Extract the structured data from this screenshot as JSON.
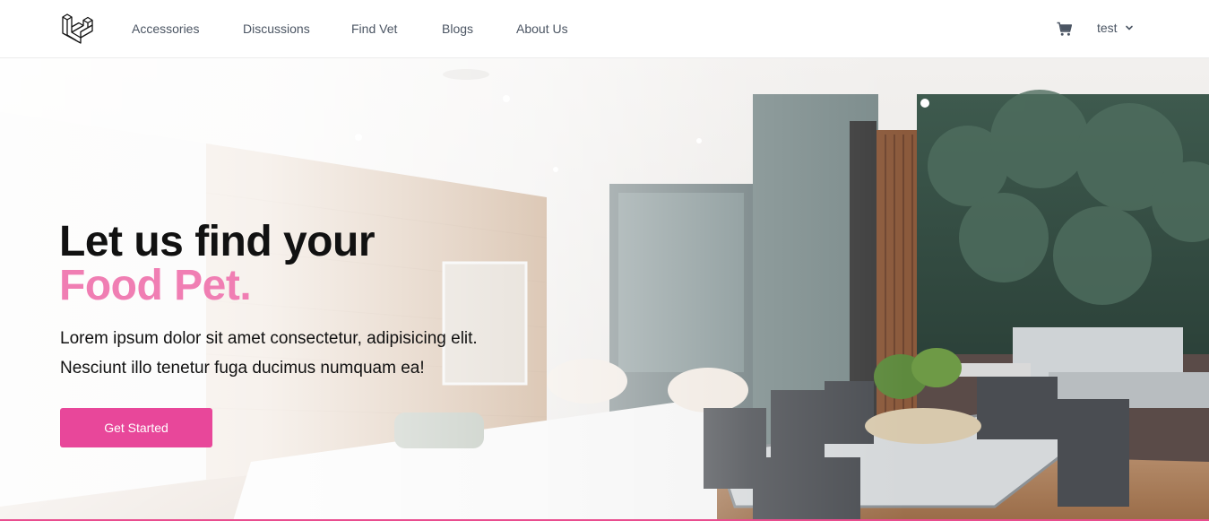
{
  "nav": {
    "links": [
      {
        "label": "Accessories"
      },
      {
        "label": "Discussions"
      },
      {
        "label": "Find Vet"
      },
      {
        "label": "Blogs"
      },
      {
        "label": "About Us"
      }
    ],
    "cart_icon": "cart-icon",
    "user": {
      "name": "test",
      "menu_icon": "chevron-down-icon"
    }
  },
  "hero": {
    "title_line1": "Let us find your",
    "title_line2": "Food Pet.",
    "subtitle_line1": "Lorem ipsum dolor sit amet consectetur, adipisicing elit.",
    "subtitle_line2": "Nesciunt illo tenetur fuga ducimus numquam ea!",
    "cta_label": "Get Started"
  },
  "colors": {
    "accent": "#e8479a",
    "accent_light": "#f07eb3",
    "nav_text": "#4b5563",
    "text": "#111111"
  }
}
